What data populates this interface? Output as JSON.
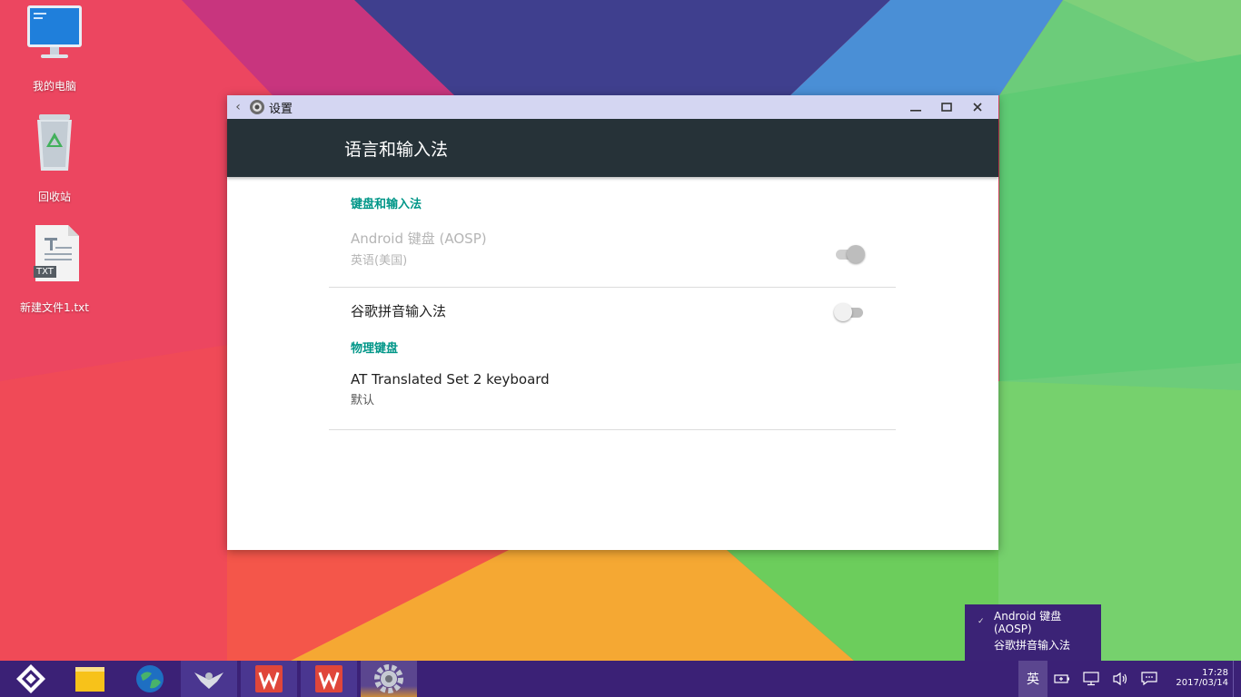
{
  "desktop": {
    "icons": [
      {
        "label": "我的电脑",
        "icon": "computer-icon"
      },
      {
        "label": "回收站",
        "icon": "recycle-bin-icon"
      },
      {
        "label": "新建文件1.txt",
        "icon": "text-file-icon",
        "badge": "TXT"
      }
    ]
  },
  "window": {
    "title": "设置",
    "back_icon": "back-arrow-icon",
    "app_icon": "gear-icon",
    "controls": [
      "minimize-icon",
      "maximize-icon",
      "close-icon"
    ],
    "header": "语言和输入法",
    "sections": [
      {
        "title": "键盘和输入法",
        "items": [
          {
            "title": "Android 键盘 (AOSP)",
            "summary": "英语(美国)",
            "toggle": true,
            "enabled": false
          },
          {
            "title": "谷歌拼音输入法",
            "toggle": false,
            "enabled": true
          }
        ]
      },
      {
        "title": "物理键盘",
        "items": [
          {
            "title": "AT Translated Set 2 keyboard",
            "summary": "默认"
          }
        ]
      }
    ]
  },
  "ime_popup": {
    "selected_line1": "Android 键盘",
    "selected_line2": "(AOSP)",
    "other": "谷歌拼音输入法",
    "check_icon": "check-icon"
  },
  "taskbar": {
    "start_icon": "start-menu-icon",
    "apps": [
      "file-manager-icon",
      "browser-icon",
      "eagle-app-icon",
      "wps-writer-icon",
      "wps-writer-icon",
      "settings-gear-icon"
    ],
    "tray": {
      "ime_label": "英",
      "icons": [
        "battery-icon",
        "display-icon",
        "volume-icon",
        "notification-icon"
      ]
    },
    "time": "17:28",
    "date": "2017/03/14"
  },
  "colors": {
    "accent": "#009688",
    "appbar": "#263238",
    "titlebar": "#d4d6f2",
    "taskbar": "#3b2176"
  }
}
